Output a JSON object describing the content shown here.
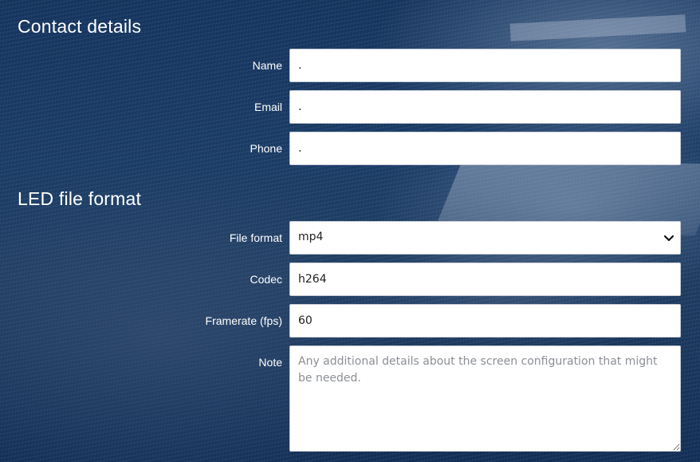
{
  "contact": {
    "title": "Contact details",
    "name_label": "Name",
    "name_value": ".",
    "email_label": "Email",
    "email_value": ".",
    "phone_label": "Phone",
    "phone_value": "."
  },
  "led": {
    "title": "LED file format",
    "file_format_label": "File format",
    "file_format_value": "mp4",
    "codec_label": "Codec",
    "codec_value": "h264",
    "framerate_label": "Framerate (fps)",
    "framerate_value": "60",
    "note_label": "Note",
    "note_placeholder": "Any additional details about the screen configuration that might be needed."
  },
  "icons": {
    "select_icon": "chevron-down-icon"
  }
}
